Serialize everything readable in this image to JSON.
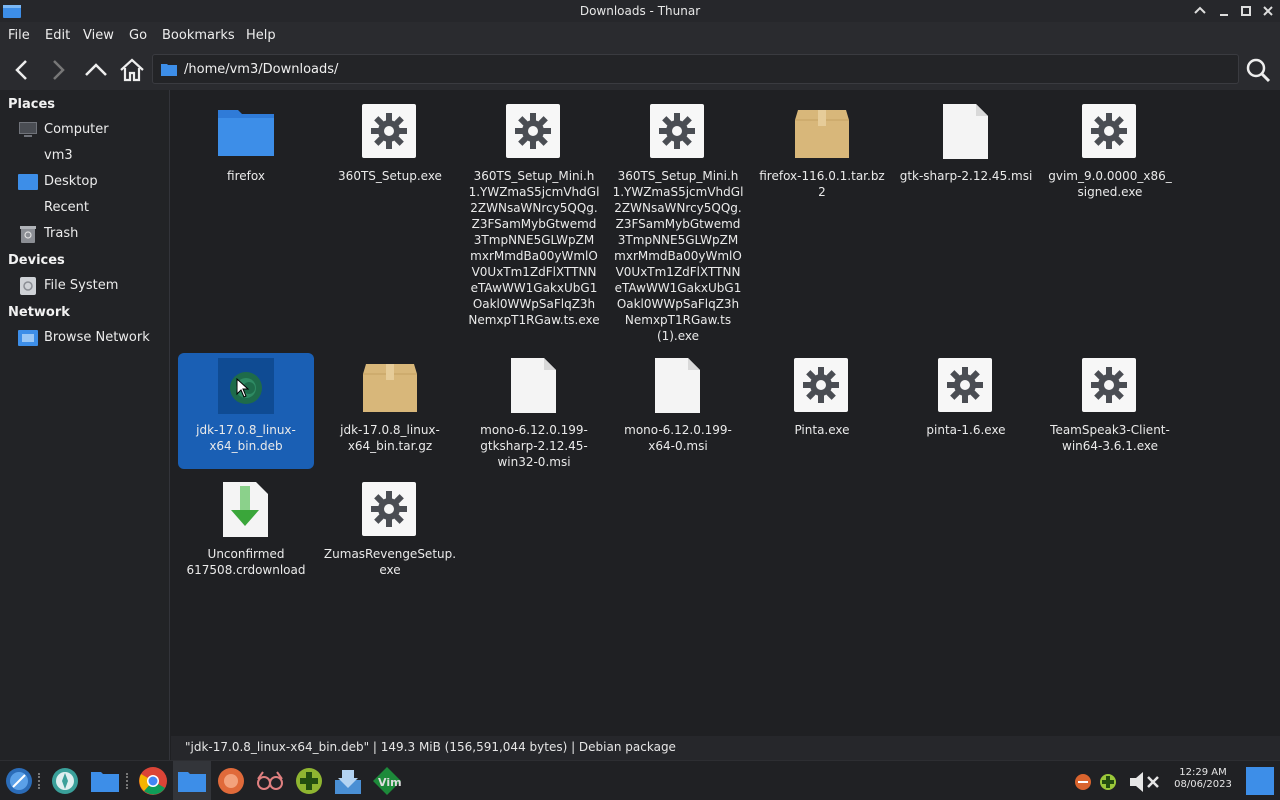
{
  "window": {
    "title": "Downloads - Thunar"
  },
  "menu": [
    "File",
    "Edit",
    "View",
    "Go",
    "Bookmarks",
    "Help"
  ],
  "location": {
    "path": "/home/vm3/Downloads/"
  },
  "sidebar": {
    "places_heading": "Places",
    "places": [
      "Computer",
      "vm3",
      "Desktop",
      "Recent",
      "Trash"
    ],
    "devices_heading": "Devices",
    "devices": [
      "File System"
    ],
    "network_heading": "Network",
    "network": [
      "Browse Network"
    ]
  },
  "files": [
    {
      "name": "firefox",
      "icon": "folder-icon"
    },
    {
      "name": "360TS_Setup.exe",
      "icon": "executable-gear-icon"
    },
    {
      "name": "360TS_Setup_Mini.h\n1.YWZmaS5jcmVhdGl\n2ZWNsaWNrcy5QQg.\nZ3FSamMybGtwemd\n3TmpNNE5GLWpZM\nmxrMmdBa00yWmlO\nV0UxTm1ZdFlXTTNN\neTAwWW1GakxUbG1\nOakl0WWpSaFlqZ3h\nNemxpT1RGaw.ts.exe",
      "icon": "executable-gear-icon"
    },
    {
      "name": "360TS_Setup_Mini.h\n1.YWZmaS5jcmVhdGl\n2ZWNsaWNrcy5QQg.\nZ3FSamMybGtwemd\n3TmpNNE5GLWpZM\nmxrMmdBa00yWmlO\nV0UxTm1ZdFlXTTNN\neTAwWW1GakxUbG1\nOakl0WWpSaFlqZ3h\nNemxpT1RGaw.ts\n(1).exe",
      "icon": "executable-gear-icon"
    },
    {
      "name": "firefox-116.0.1.tar.bz\n2",
      "icon": "archive-box-icon"
    },
    {
      "name": "gtk-sharp-2.12.45.msi",
      "icon": "blank-document-icon"
    },
    {
      "name": "gvim_9.0.0000_x86_\nsigned.exe",
      "icon": "executable-gear-icon"
    },
    {
      "name": "jdk-17.0.8_linux-\nx64_bin.deb",
      "icon": "debian-package-icon",
      "selected": true
    },
    {
      "name": "jdk-17.0.8_linux-\nx64_bin.tar.gz",
      "icon": "archive-box-icon"
    },
    {
      "name": "mono-6.12.0.199-\ngtksharp-2.12.45-\nwin32-0.msi",
      "icon": "blank-document-icon"
    },
    {
      "name": "mono-6.12.0.199-\nx64-0.msi",
      "icon": "blank-document-icon"
    },
    {
      "name": "Pinta.exe",
      "icon": "executable-gear-icon"
    },
    {
      "name": "pinta-1.6.exe",
      "icon": "executable-gear-icon"
    },
    {
      "name": "TeamSpeak3-Client-\nwin64-3.6.1.exe",
      "icon": "executable-gear-icon"
    },
    {
      "name": "Unconfirmed\n617508.crdownload",
      "icon": "download-arrow-icon"
    },
    {
      "name": "ZumasRevengeSetup.\nexe",
      "icon": "executable-gear-icon"
    }
  ],
  "status": {
    "text": "\"jdk-17.0.8_linux-x64_bin.deb\"  |  149.3 MiB (156,591,044 bytes)  |  Debian package"
  },
  "clock": {
    "time": "12:29 AM",
    "date": "08/06/2023"
  },
  "colors": {
    "selection": "#1a5fb4",
    "folder": "#3d8ee8",
    "archive": "#d8b77a"
  }
}
